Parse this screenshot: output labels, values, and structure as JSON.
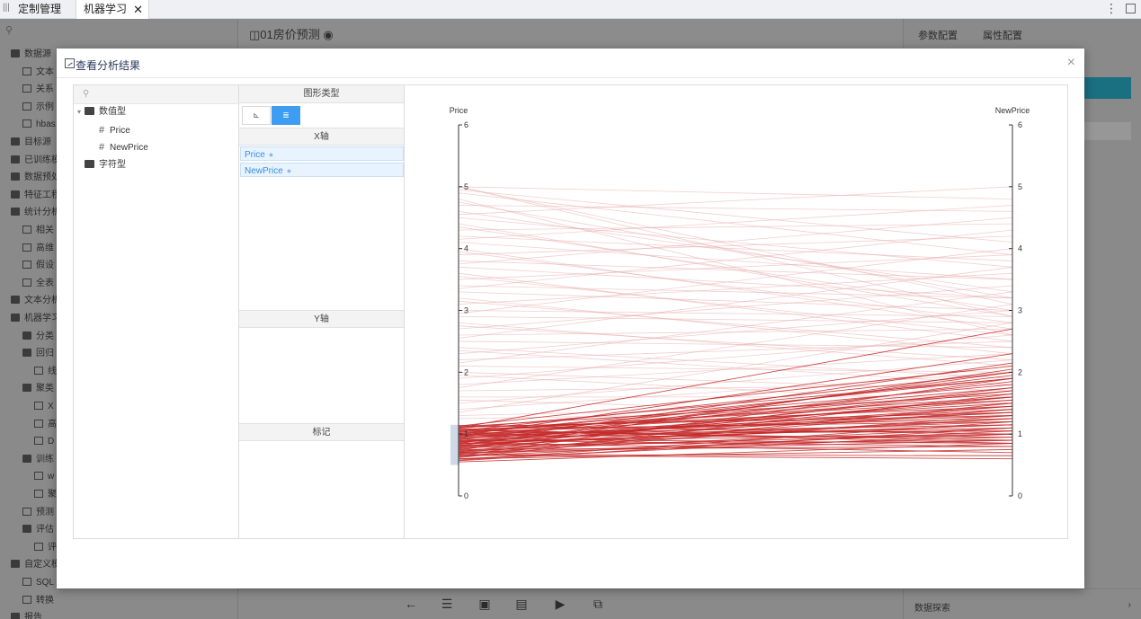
{
  "tabs": [
    {
      "label": "定制管理"
    },
    {
      "label": "机器学习"
    }
  ],
  "icons": {
    "close": "close-icon",
    "kebab": "kebab-icon",
    "maximize": "maximize-icon"
  },
  "background_tree": [
    {
      "label": "数据源",
      "kind": "folder",
      "depth": 0
    },
    {
      "label": "文本",
      "kind": "file",
      "depth": 1
    },
    {
      "label": "关系",
      "kind": "file",
      "depth": 1
    },
    {
      "label": "示例",
      "kind": "file",
      "depth": 1
    },
    {
      "label": "hbas",
      "kind": "file",
      "depth": 1
    },
    {
      "label": "目标源",
      "kind": "folder",
      "depth": 0
    },
    {
      "label": "已训练模",
      "kind": "folder",
      "depth": 0
    },
    {
      "label": "数据预处",
      "kind": "folder",
      "depth": 0
    },
    {
      "label": "特征工程",
      "kind": "folder",
      "depth": 0
    },
    {
      "label": "统计分析",
      "kind": "folder",
      "depth": 0
    },
    {
      "label": "相关",
      "kind": "file",
      "depth": 1
    },
    {
      "label": "高维",
      "kind": "file",
      "depth": 1
    },
    {
      "label": "假设",
      "kind": "file",
      "depth": 1
    },
    {
      "label": "全表",
      "kind": "file",
      "depth": 1
    },
    {
      "label": "文本分析",
      "kind": "folder",
      "depth": 0
    },
    {
      "label": "机器学习",
      "kind": "folder",
      "depth": 0
    },
    {
      "label": "分类",
      "kind": "folder",
      "depth": 1
    },
    {
      "label": "回归",
      "kind": "folder",
      "depth": 1
    },
    {
      "label": "线",
      "kind": "file",
      "depth": 2
    },
    {
      "label": "聚类",
      "kind": "folder",
      "depth": 1
    },
    {
      "label": "X",
      "kind": "file",
      "depth": 2
    },
    {
      "label": "高",
      "kind": "file",
      "depth": 2
    },
    {
      "label": "D",
      "kind": "file",
      "depth": 2
    },
    {
      "label": "训练",
      "kind": "folder",
      "depth": 1
    },
    {
      "label": "w",
      "kind": "file",
      "depth": 2
    },
    {
      "label": "聚",
      "kind": "file",
      "depth": 2
    },
    {
      "label": "预测",
      "kind": "file",
      "depth": 1
    },
    {
      "label": "评估",
      "kind": "folder",
      "depth": 1
    },
    {
      "label": "评",
      "kind": "file",
      "depth": 2
    },
    {
      "label": "自定义模",
      "kind": "folder",
      "depth": 0
    },
    {
      "label": "SQL",
      "kind": "file",
      "depth": 1
    },
    {
      "label": "转换",
      "kind": "file",
      "depth": 1
    },
    {
      "label": "报告",
      "kind": "folder",
      "depth": 0
    }
  ],
  "document": {
    "title": "01房价预测"
  },
  "bottom_toolbar": [
    {
      "icon": "back-arrow-icon",
      "glyph": "←"
    },
    {
      "icon": "list-icon",
      "glyph": "☰"
    },
    {
      "icon": "save-icon",
      "glyph": "▣"
    },
    {
      "icon": "save-as-icon",
      "glyph": "▤"
    },
    {
      "icon": "run-icon",
      "glyph": "▶"
    },
    {
      "icon": "export-icon",
      "glyph": "⧉"
    }
  ],
  "right_panel": {
    "tabs": [
      "参数配置",
      "属性配置"
    ],
    "footer_label": "数据探索",
    "footer_chevron": "›"
  },
  "modal": {
    "title": "查看分析结果",
    "close_glyph": "×",
    "field_tree": {
      "groups": [
        {
          "label": "数值型",
          "expanded": true,
          "fields": [
            "Price",
            "NewPrice"
          ]
        },
        {
          "label": "字符型",
          "expanded": false,
          "fields": []
        }
      ]
    },
    "config": {
      "chart_type_header": "图形类型",
      "chart_type_buttons": [
        {
          "glyph": "⊾",
          "icon": "scatter-chart-icon",
          "active": false
        },
        {
          "glyph": "≣",
          "icon": "parallel-coordinates-icon",
          "active": true
        }
      ],
      "x_axis_header": "X轴",
      "x_axis_fields": [
        "Price",
        "NewPrice"
      ],
      "y_axis_header": "Y轴",
      "marks_header": "标记"
    }
  },
  "chart_data": {
    "type": "parallel_coordinates",
    "axes": [
      {
        "name": "Price",
        "min": 0,
        "max": 6,
        "ticks": [
          "0",
          "1",
          "2",
          "3",
          "4",
          "5",
          "6"
        ]
      },
      {
        "name": "NewPrice",
        "min": 0,
        "max": 6,
        "ticks": [
          "0",
          "1",
          "2",
          "3",
          "4",
          "5",
          "6"
        ]
      }
    ],
    "brush": {
      "axis": "Price",
      "range": [
        0.5,
        1.15
      ]
    },
    "highlight_color": "#c42a2a",
    "faded_color": "#e8a7a7",
    "lines_highlighted": [
      [
        0.55,
        0.85
      ],
      [
        0.58,
        1.2
      ],
      [
        0.6,
        0.75
      ],
      [
        0.62,
        1.5
      ],
      [
        0.64,
        1.05
      ],
      [
        0.65,
        1.9
      ],
      [
        0.67,
        0.65
      ],
      [
        0.68,
        1.3
      ],
      [
        0.7,
        0.95
      ],
      [
        0.71,
        1.75
      ],
      [
        0.72,
        1.1
      ],
      [
        0.74,
        2.05
      ],
      [
        0.75,
        0.8
      ],
      [
        0.76,
        1.45
      ],
      [
        0.78,
        1.0
      ],
      [
        0.79,
        1.6
      ],
      [
        0.8,
        1.25
      ],
      [
        0.82,
        0.9
      ],
      [
        0.83,
        1.85
      ],
      [
        0.84,
        1.15
      ],
      [
        0.85,
        2.15
      ],
      [
        0.86,
        0.7
      ],
      [
        0.87,
        1.35
      ],
      [
        0.88,
        1.0
      ],
      [
        0.89,
        1.55
      ],
      [
        0.9,
        1.2
      ],
      [
        0.91,
        1.95
      ],
      [
        0.92,
        0.85
      ],
      [
        0.93,
        1.4
      ],
      [
        0.94,
        1.1
      ],
      [
        0.95,
        1.7
      ],
      [
        0.96,
        1.3
      ],
      [
        0.97,
        2.3
      ],
      [
        0.98,
        0.95
      ],
      [
        0.99,
        1.5
      ],
      [
        1.0,
        1.15
      ],
      [
        1.01,
        1.8
      ],
      [
        1.02,
        1.05
      ],
      [
        1.03,
        1.6
      ],
      [
        1.04,
        1.25
      ],
      [
        1.05,
        2.0
      ],
      [
        1.06,
        0.9
      ],
      [
        1.07,
        1.45
      ],
      [
        1.08,
        1.2
      ],
      [
        1.09,
        1.9
      ],
      [
        1.1,
        2.7
      ],
      [
        1.11,
        1.35
      ],
      [
        1.12,
        1.65
      ],
      [
        1.13,
        2.1
      ],
      [
        1.14,
        1.0
      ],
      [
        0.6,
        1.0
      ],
      [
        0.7,
        1.4
      ],
      [
        0.8,
        1.6
      ],
      [
        0.9,
        0.8
      ],
      [
        1.0,
        1.9
      ],
      [
        0.57,
        1.1
      ],
      [
        0.66,
        0.6
      ],
      [
        0.77,
        1.7
      ],
      [
        0.88,
        1.45
      ],
      [
        0.99,
        1.05
      ],
      [
        1.05,
        1.55
      ],
      [
        0.73,
        1.25
      ],
      [
        0.81,
        2.0
      ],
      [
        0.94,
        1.35
      ],
      [
        1.08,
        0.85
      ],
      [
        0.63,
        1.65
      ],
      [
        0.85,
        1.15
      ],
      [
        0.97,
        1.75
      ],
      [
        1.12,
        1.3
      ],
      [
        0.69,
        0.9
      ]
    ],
    "lines_faded": [
      [
        1.3,
        1.5
      ],
      [
        1.5,
        2.2
      ],
      [
        1.7,
        1.8
      ],
      [
        1.9,
        2.6
      ],
      [
        2.1,
        2.0
      ],
      [
        2.3,
        3.0
      ],
      [
        2.5,
        2.4
      ],
      [
        2.7,
        3.4
      ],
      [
        2.9,
        2.8
      ],
      [
        3.1,
        3.6
      ],
      [
        3.3,
        3.0
      ],
      [
        3.5,
        3.9
      ],
      [
        3.7,
        3.2
      ],
      [
        3.9,
        4.2
      ],
      [
        4.1,
        3.5
      ],
      [
        4.3,
        4.4
      ],
      [
        4.5,
        3.7
      ],
      [
        4.7,
        4.6
      ],
      [
        4.9,
        3.9
      ],
      [
        5.0,
        4.8
      ],
      [
        5.0,
        3.1
      ],
      [
        4.8,
        2.6
      ],
      [
        4.6,
        3.3
      ],
      [
        4.4,
        2.9
      ],
      [
        4.2,
        3.8
      ],
      [
        4.0,
        2.7
      ],
      [
        3.8,
        3.5
      ],
      [
        3.6,
        2.5
      ],
      [
        3.4,
        3.2
      ],
      [
        3.2,
        2.3
      ],
      [
        3.0,
        2.9
      ],
      [
        2.8,
        2.1
      ],
      [
        2.6,
        2.7
      ],
      [
        2.4,
        1.9
      ],
      [
        2.2,
        2.5
      ],
      [
        2.0,
        1.7
      ],
      [
        1.8,
        2.3
      ],
      [
        1.6,
        1.6
      ],
      [
        1.4,
        2.0
      ],
      [
        1.25,
        1.4
      ],
      [
        1.35,
        2.8
      ],
      [
        1.55,
        1.3
      ],
      [
        1.75,
        3.1
      ],
      [
        1.95,
        1.5
      ],
      [
        2.15,
        3.3
      ],
      [
        2.35,
        1.8
      ],
      [
        2.55,
        3.7
      ],
      [
        2.75,
        2.2
      ],
      [
        2.95,
        4.0
      ],
      [
        3.15,
        2.4
      ],
      [
        3.35,
        4.3
      ],
      [
        3.55,
        2.6
      ],
      [
        3.75,
        4.5
      ],
      [
        3.95,
        2.8
      ],
      [
        4.15,
        4.7
      ],
      [
        4.35,
        3.0
      ],
      [
        4.55,
        5.0
      ],
      [
        4.75,
        3.2
      ],
      [
        4.95,
        4.1
      ],
      [
        5.0,
        2.9
      ]
    ]
  }
}
